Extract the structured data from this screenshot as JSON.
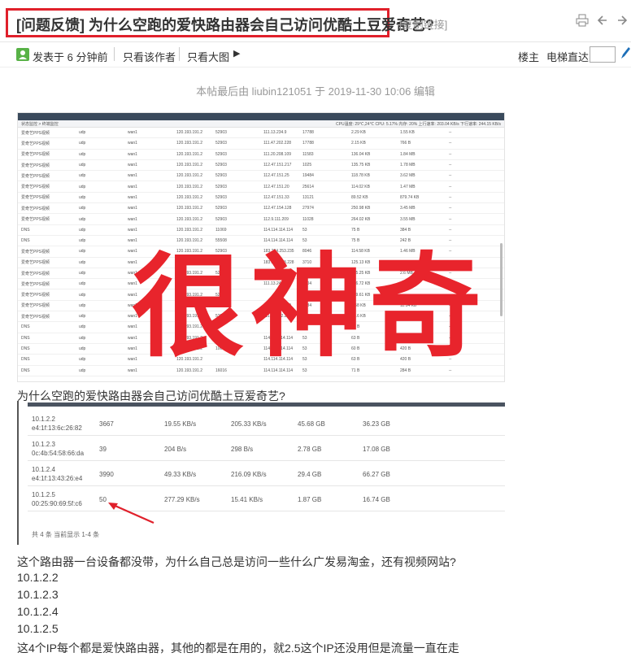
{
  "header": {
    "title": "[问题反馈] 为什么空跑的爱快路由器会自己访问优酷土豆爱奇艺?",
    "copy_link": "[复制链接]"
  },
  "meta": {
    "posted": "发表于 6 分钟前",
    "only_author": "只看该作者",
    "big_pic": "只看大图",
    "floor": "楼主",
    "jump": "电梯直达",
    "jump_value": ""
  },
  "edited": "本帖最后由 liubin121051 于 2019-11-30 10:06 编辑",
  "shot1": {
    "breadcrumb": "状态监控 > 终端监控",
    "status": "CPU温度: 29℃,24℃   CPU: 5.17%   内存: 20%   上行速率: 203.04 KB/s   下行速率: 244.15 KB/s",
    "overlay": "很神奇",
    "rows": [
      [
        "爱奇艺PPS视频",
        "udp",
        "wan1",
        "120.193.191.2",
        "52903",
        "111.13.234.9",
        "17788",
        "2.29 KB",
        "1.55 KB",
        "--"
      ],
      [
        "爱奇艺PPS视频",
        "udp",
        "wan1",
        "120.193.191.2",
        "52903",
        "111.47.202.228",
        "17788",
        "2.15 KB",
        "766 B",
        "--"
      ],
      [
        "爱奇艺PPS视频",
        "udp",
        "wan1",
        "120.193.191.2",
        "52903",
        "111.20.208.109",
        "11583",
        "136.04 KB",
        "1.84 MB",
        "--"
      ],
      [
        "爱奇艺PPS视频",
        "udp",
        "wan1",
        "120.193.191.2",
        "52903",
        "112.47.151.217",
        "1025",
        "135.75 KB",
        "1.78 MB",
        "--"
      ],
      [
        "爱奇艺PPS视频",
        "udp",
        "wan1",
        "120.193.191.2",
        "52903",
        "112.47.151.25",
        "19484",
        "118.78 KB",
        "3.62 MB",
        "--"
      ],
      [
        "爱奇艺PPS视频",
        "udp",
        "wan1",
        "120.193.191.2",
        "52903",
        "112.47.151.20",
        "25614",
        "114.02 KB",
        "1.47 MB",
        "--"
      ],
      [
        "爱奇艺PPS视频",
        "udp",
        "wan1",
        "120.193.191.2",
        "52903",
        "112.47.151.33",
        "13121",
        "89.52 KB",
        "879.74 KB",
        "--"
      ],
      [
        "爱奇艺PPS视频",
        "udp",
        "wan1",
        "120.193.191.2",
        "52903",
        "112.47.154.128",
        "27974",
        "250.98 KB",
        "3.45 MB",
        "--"
      ],
      [
        "爱奇艺PPS视频",
        "udp",
        "wan1",
        "120.193.191.2",
        "52903",
        "112.9.111.209",
        "11028",
        "264.02 KB",
        "3.55 MB",
        "--"
      ],
      [
        "DNS",
        "udp",
        "wan1",
        "120.193.191.2",
        "11069",
        "114.114.114.114",
        "53",
        "75 B",
        "384 B",
        "--"
      ],
      [
        "DNS",
        "udp",
        "wan1",
        "120.193.191.2",
        "55508",
        "114.114.114.114",
        "53",
        "75 B",
        "242 B",
        "--"
      ],
      [
        "爱奇艺PPS视频",
        "udp",
        "wan1",
        "120.193.191.2",
        "52903",
        "183.234.253.235",
        "8046",
        "114.58 KB",
        "1.46 MB",
        "--"
      ],
      [
        "爱奇艺PPS视频",
        "udp",
        "wan1",
        "120.193.191.2",
        "52903",
        "183.234.253.228",
        "3710",
        "125.13 KB",
        "1.61 MB",
        "--"
      ],
      [
        "爱奇艺PPS视频",
        "udp",
        "wan1",
        "120.193.191.2",
        "52903",
        "111.13.24.46",
        "4701",
        "215.25 KB",
        "2.6 MB",
        "--"
      ],
      [
        "爱奇艺PPS视频",
        "udp",
        "wan1",
        "120.193.191.2",
        "52903",
        "111.13.24.36",
        "4104",
        "216.72 KB",
        "",
        "--"
      ],
      [
        "爱奇艺PPS视频",
        "udp",
        "wan1",
        "120.193.191.2",
        "52903",
        "",
        "11028",
        "109.61 KB",
        "",
        "--"
      ],
      [
        "爱奇艺PPS视频",
        "udp",
        "wan1",
        "120.193.191.2",
        "52903",
        "111.20.208.199",
        "7134",
        "8.58 KB",
        "11.14 KB",
        "--"
      ],
      [
        "爱奇艺PPS视频",
        "udp",
        "wan1",
        "120.193.191.2",
        "52903",
        "111.47.202.223",
        "7134",
        "47.6 KB",
        "",
        "--"
      ],
      [
        "DNS",
        "udp",
        "wan1",
        "120.193.191.2",
        "",
        "",
        "53",
        "63 B",
        "",
        "--"
      ],
      [
        "DNS",
        "udp",
        "wan1",
        "120.193.191.2",
        "",
        "114.114.114.114",
        "53",
        "63 B",
        "",
        "--"
      ],
      [
        "DNS",
        "udp",
        "wan1",
        "120.193.191.2",
        "10077",
        "114.114.114.114",
        "53",
        "60 B",
        "420 B",
        "--"
      ],
      [
        "DNS",
        "udp",
        "wan1",
        "120.193.191.2",
        "",
        "114.114.114.114",
        "53",
        "63 B",
        "420 B",
        "--"
      ],
      [
        "DNS",
        "udp",
        "wan1",
        "120.193.191.2",
        "16016",
        "114.114.114.114",
        "53",
        "71 B",
        "284 B",
        "--"
      ]
    ]
  },
  "caption": "为什么空跑的爱快路由器会自己访问优酷土豆爱奇艺?",
  "shot2": {
    "rows": [
      {
        "ip": "10.1.2.2",
        "mac": "e4:1f:13:6c:26:82",
        "conn": "3667",
        "up": "19.55 KB/s",
        "down": "205.33 KB/s",
        "total_up": "45.68 GB",
        "total_down": "36.23 GB"
      },
      {
        "ip": "10.1.2.3",
        "mac": "0c:4b:54:58:66:da",
        "conn": "39",
        "up": "204 B/s",
        "down": "298 B/s",
        "total_up": "2.78 GB",
        "total_down": "17.08 GB"
      },
      {
        "ip": "10.1.2.4",
        "mac": "e4:1f:13:43:26:e4",
        "conn": "3990",
        "up": "49.33 KB/s",
        "down": "216.09 KB/s",
        "total_up": "29.4 GB",
        "total_down": "66.27 GB"
      },
      {
        "ip": "10.1.2.5",
        "mac": "00:25:90:69:5f:c6",
        "conn": "50",
        "up": "277.29 KB/s",
        "down": "15.41 KB/s",
        "total_up": "1.87 GB",
        "total_down": "16.74 GB"
      }
    ],
    "footer": "共 4 条 当前显示 1-4 条"
  },
  "body_lines": [
    "这个路由器一台设备都没带，为什么自己总是访问一些什么广发易淘金，还有视频网站?",
    "10.1.2.2",
    "10.1.2.3",
    "10.1.2.4",
    "10.1.2.5",
    "这4个IP每个都是爱快路由器，其他的都是在用的，就2.5这个IP还没用但是流量一直在走"
  ],
  "colors": {
    "highlight_red": "#e0202b",
    "overlay_red": "#e8242c"
  }
}
